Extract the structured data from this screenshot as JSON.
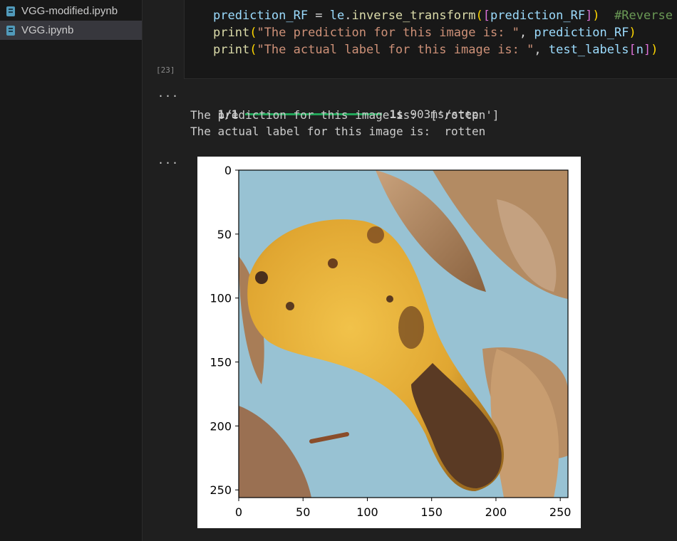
{
  "sidebar": {
    "files": [
      {
        "name": "VGG-modified.ipynb",
        "active": false
      },
      {
        "name": "VGG.ipynb",
        "active": true
      }
    ]
  },
  "cell": {
    "execution_count": "[23]",
    "code_lines": [
      {
        "tokens": [
          [
            "var",
            "prediction_RF"
          ],
          [
            "op",
            " = "
          ],
          [
            "var",
            "le"
          ],
          [
            "op",
            "."
          ],
          [
            "fn",
            "inverse_transform"
          ],
          [
            "br1",
            "("
          ],
          [
            "br2",
            "["
          ],
          [
            "var",
            "prediction_RF"
          ],
          [
            "br2",
            "]"
          ],
          [
            "br1",
            ")"
          ],
          [
            "op",
            "  "
          ],
          [
            "cmt",
            "#Reverse the"
          ]
        ]
      },
      {
        "tokens": [
          [
            "fn",
            "print"
          ],
          [
            "br1",
            "("
          ],
          [
            "str",
            "\"The prediction for this image is: \""
          ],
          [
            "op",
            ", "
          ],
          [
            "var",
            "prediction_RF"
          ],
          [
            "br1",
            ")"
          ]
        ]
      },
      {
        "tokens": [
          [
            "fn",
            "print"
          ],
          [
            "br1",
            "("
          ],
          [
            "str",
            "\"The actual label for this image is: \""
          ],
          [
            "op",
            ", "
          ],
          [
            "var",
            "test_labels"
          ],
          [
            "br2",
            "["
          ],
          [
            "var",
            "n"
          ],
          [
            "br2",
            "]"
          ],
          [
            "br1",
            ")"
          ]
        ]
      }
    ]
  },
  "output": {
    "progress_prefix": "1/1",
    "progress_percent": 100,
    "progress_time": "1s",
    "progress_rate": "903ms/step",
    "prediction_line": "The prediction for this image is:  ['rotten']",
    "actual_line": "The actual label for this image is:  rotten"
  },
  "plot": {
    "image_subject": "rotten banana on light-blue background with dry leaves",
    "y_ticks": [
      "0",
      "50",
      "100",
      "150",
      "200",
      "250"
    ],
    "x_ticks": [
      "0",
      "50",
      "100",
      "150",
      "200",
      "250"
    ],
    "x_range": [
      0,
      256
    ],
    "y_range": [
      0,
      256
    ]
  },
  "colors": {
    "progress": "#23a55a",
    "background": "#1f1f1f",
    "sidebar_active": "#37373d"
  }
}
